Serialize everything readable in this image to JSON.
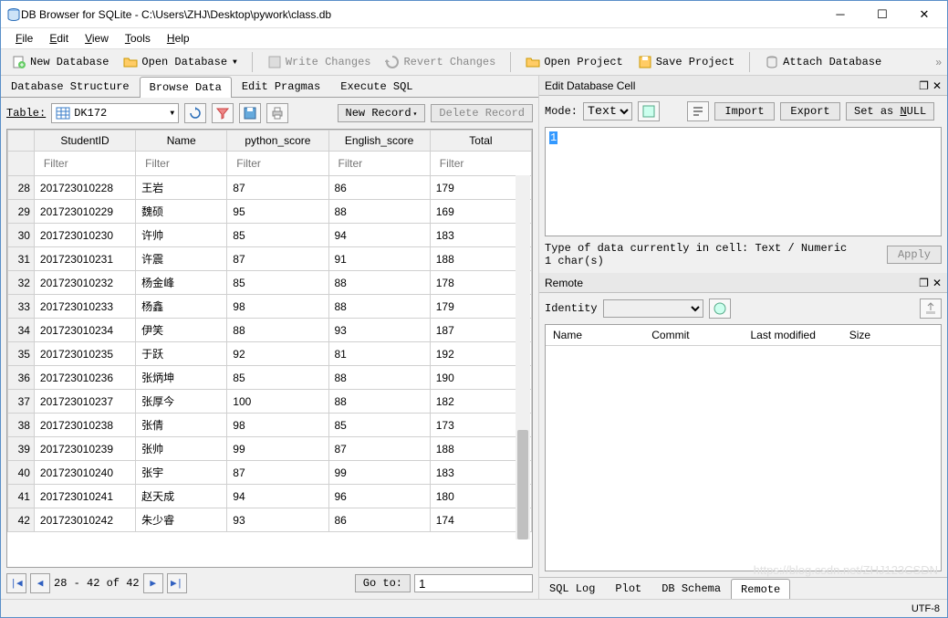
{
  "window": {
    "title": "DB Browser for SQLite - C:\\Users\\ZHJ\\Desktop\\pywork\\class.db"
  },
  "menubar": [
    "File",
    "Edit",
    "View",
    "Tools",
    "Help"
  ],
  "toolbar": {
    "new_db": "New Database",
    "open_db": "Open Database",
    "write_changes": "Write Changes",
    "revert_changes": "Revert Changes",
    "open_project": "Open Project",
    "save_project": "Save Project",
    "attach_db": "Attach Database"
  },
  "tabs": {
    "db_structure": "Database Structure",
    "browse_data": "Browse Data",
    "edit_pragmas": "Edit Pragmas",
    "execute_sql": "Execute SQL"
  },
  "browse": {
    "table_label": "Table:",
    "table_name": "DK172",
    "new_record": "New Record",
    "delete_record": "Delete Record",
    "columns": [
      "StudentID",
      "Name",
      "python_score",
      "English_score",
      "Total"
    ],
    "filter_placeholder": "Filter",
    "rows": [
      {
        "n": 28,
        "id": "201723010228",
        "name": "王岩",
        "py": "87",
        "en": "86",
        "tot": "179"
      },
      {
        "n": 29,
        "id": "201723010229",
        "name": "魏硕",
        "py": "95",
        "en": "88",
        "tot": "169"
      },
      {
        "n": 30,
        "id": "201723010230",
        "name": "许帅",
        "py": "85",
        "en": "94",
        "tot": "183"
      },
      {
        "n": 31,
        "id": "201723010231",
        "name": "许震",
        "py": "87",
        "en": "91",
        "tot": "188"
      },
      {
        "n": 32,
        "id": "201723010232",
        "name": "杨金峰",
        "py": "85",
        "en": "88",
        "tot": "178"
      },
      {
        "n": 33,
        "id": "201723010233",
        "name": "杨鑫",
        "py": "98",
        "en": "88",
        "tot": "179"
      },
      {
        "n": 34,
        "id": "201723010234",
        "name": "伊笑",
        "py": "88",
        "en": "93",
        "tot": "187"
      },
      {
        "n": 35,
        "id": "201723010235",
        "name": "于跃",
        "py": "92",
        "en": "81",
        "tot": "192"
      },
      {
        "n": 36,
        "id": "201723010236",
        "name": "张炳坤",
        "py": "85",
        "en": "88",
        "tot": "190"
      },
      {
        "n": 37,
        "id": "201723010237",
        "name": "张厚今",
        "py": "100",
        "en": "88",
        "tot": "182"
      },
      {
        "n": 38,
        "id": "201723010238",
        "name": "张倩",
        "py": "98",
        "en": "85",
        "tot": "173"
      },
      {
        "n": 39,
        "id": "201723010239",
        "name": "张帅",
        "py": "99",
        "en": "87",
        "tot": "188"
      },
      {
        "n": 40,
        "id": "201723010240",
        "name": "张宇",
        "py": "87",
        "en": "99",
        "tot": "183"
      },
      {
        "n": 41,
        "id": "201723010241",
        "name": "赵天成",
        "py": "94",
        "en": "96",
        "tot": "180"
      },
      {
        "n": 42,
        "id": "201723010242",
        "name": "朱少睿",
        "py": "93",
        "en": "86",
        "tot": "174"
      }
    ],
    "nav_text": "28 - 42 of 42",
    "goto": "Go to:",
    "goto_val": "1"
  },
  "editcell": {
    "title": "Edit Database Cell",
    "mode_label": "Mode:",
    "mode_value": "Text",
    "import": "Import",
    "export": "Export",
    "set_null": "Set as NULL",
    "cell_value": "1",
    "type_line1": "Type of data currently in cell: Text / Numeric",
    "type_line2": "1 char(s)",
    "apply": "Apply"
  },
  "remote": {
    "title": "Remote",
    "identity": "Identity",
    "cols": [
      "Name",
      "Commit",
      "Last modified",
      "Size"
    ]
  },
  "bottom_tabs": [
    "SQL Log",
    "Plot",
    "DB Schema",
    "Remote"
  ],
  "status": {
    "encoding": "UTF-8"
  },
  "watermark": "https://blog.csdn.net/ZHJ123CSDN"
}
